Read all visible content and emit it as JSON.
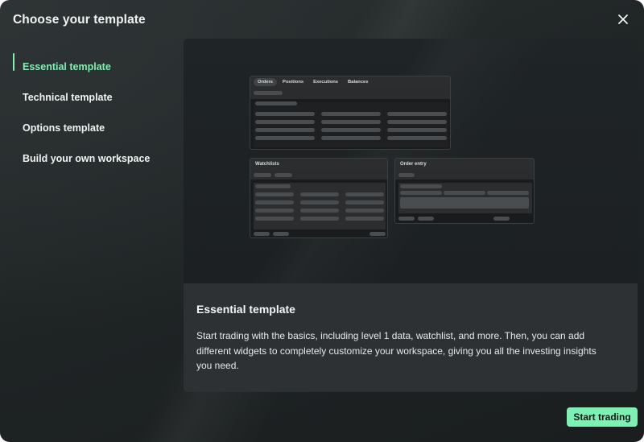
{
  "modal": {
    "title": "Choose your template",
    "close_icon": "close-icon"
  },
  "sidebar": {
    "items": [
      {
        "label": "Essential template",
        "active": true
      },
      {
        "label": "Technical template",
        "active": false
      },
      {
        "label": "Options template",
        "active": false
      },
      {
        "label": "Build your own workspace",
        "active": false
      }
    ]
  },
  "preview": {
    "orders_tabs": [
      "Orders",
      "Positions",
      "Executions",
      "Balances"
    ],
    "watchlists_title": "Watchlists",
    "order_entry_title": "Order entry"
  },
  "description": {
    "title": "Essential template",
    "text": "Start trading with the basics, including level 1 data, watchlist, and more.  Then, you can add different widgets to completely customize your workspace, giving you all the investing insights you need."
  },
  "cta": {
    "label": "Start trading"
  },
  "colors": {
    "accent": "#7ef0b4",
    "background": "#1f2425",
    "panel": "#2e3133"
  }
}
